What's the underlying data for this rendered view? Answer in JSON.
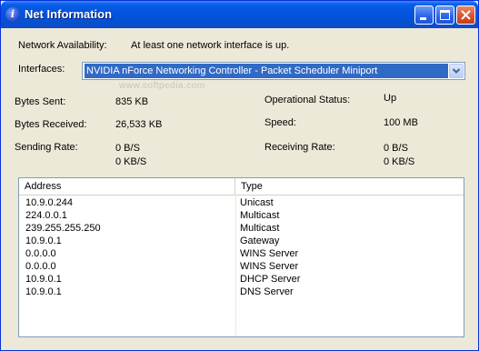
{
  "window": {
    "title": "Net Information",
    "title_icon": "info-icon"
  },
  "availability": {
    "label": "Network Availability:",
    "value": "At least one network interface is up."
  },
  "interfaces": {
    "label": "Interfaces:",
    "selected": "NVIDIA nForce Networking Controller - Packet Scheduler Miniport"
  },
  "watermark": "www.softpedia.com",
  "stats": {
    "bytes_sent_label": "Bytes Sent:",
    "bytes_sent": "835 KB",
    "bytes_received_label": "Bytes Received:",
    "bytes_received": "26,533 KB",
    "sending_rate_label": "Sending Rate:",
    "sending_rate_bs": "0 B/S",
    "sending_rate_kbs": "0 KB/S",
    "operational_status_label": "Operational Status:",
    "operational_status": "Up",
    "speed_label": "Speed:",
    "speed": "100 MB",
    "receiving_rate_label": "Receiving Rate:",
    "receiving_rate_bs": "0 B/S",
    "receiving_rate_kbs": "0 KB/S"
  },
  "addresses": {
    "columns": [
      "Address",
      "Type"
    ],
    "rows": [
      {
        "address": "10.9.0.244",
        "type": "Unicast"
      },
      {
        "address": "224.0.0.1",
        "type": "Multicast"
      },
      {
        "address": "239.255.255.250",
        "type": "Multicast"
      },
      {
        "address": "10.9.0.1",
        "type": "Gateway"
      },
      {
        "address": "0.0.0.0",
        "type": "WINS Server"
      },
      {
        "address": "0.0.0.0",
        "type": "WINS Server"
      },
      {
        "address": "10.9.0.1",
        "type": "DHCP Server"
      },
      {
        "address": "10.9.0.1",
        "type": "DNS Server"
      }
    ]
  }
}
